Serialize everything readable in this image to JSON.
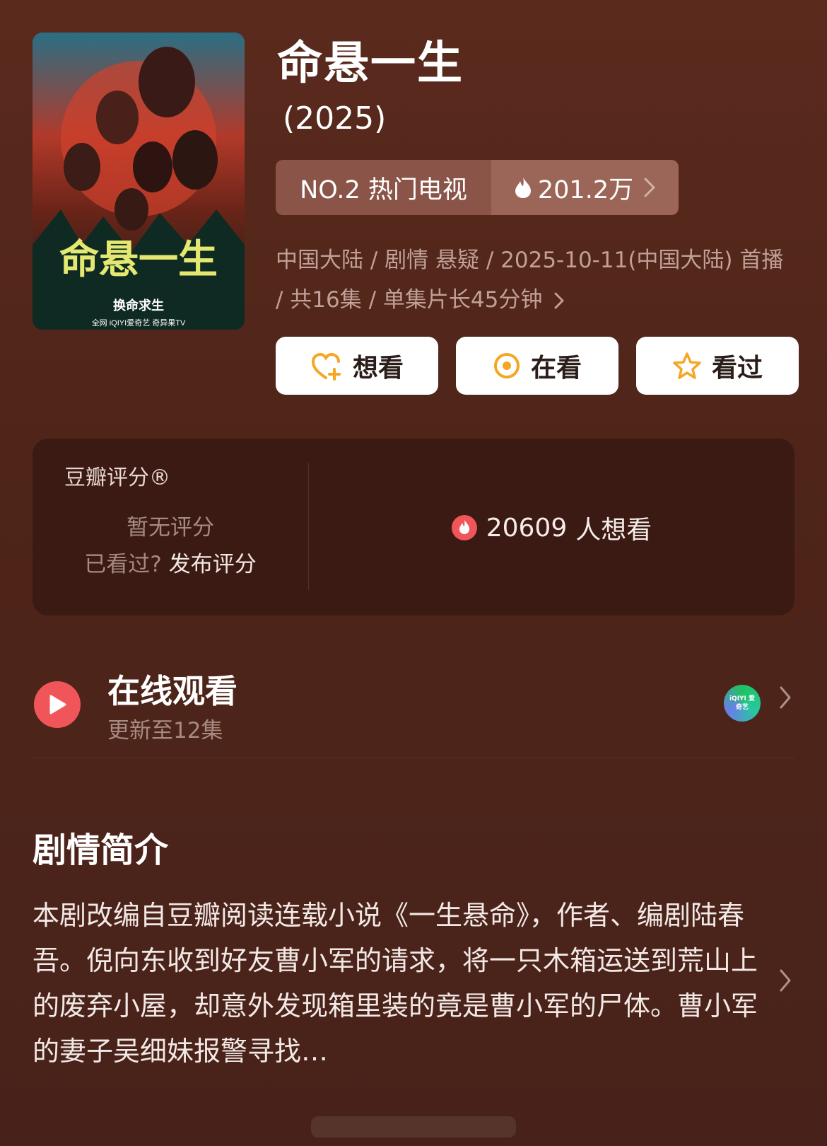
{
  "show": {
    "title": "命悬一生",
    "year": "(2025)",
    "poster": {
      "title_art": "命悬一生",
      "tagline": "换命求生",
      "footer": "全网 iQIYI爱奇艺 奇异果TV"
    }
  },
  "rank": {
    "label": "NO.2 热门电视",
    "heat": "201.2万",
    "heat_icon": "flame-icon"
  },
  "meta": {
    "text": "中国大陆 / 剧情 悬疑 / 2025-10-11(中国大陆) 首播 / 共16集 / 单集片长45分钟"
  },
  "actions": [
    {
      "label": "想看",
      "icon": "heart-plus-icon"
    },
    {
      "label": "在看",
      "icon": "target-icon"
    },
    {
      "label": "看过",
      "icon": "star-icon"
    }
  ],
  "rating": {
    "title": "豆瓣评分®",
    "none": "暂无评分",
    "watched_question": "已看过?",
    "publish_link": "发布评分",
    "want_count": "20609",
    "want_suffix": "人想看"
  },
  "online": {
    "title": "在线观看",
    "update": "更新至12集",
    "provider_logo": "iQIYI 爱奇艺"
  },
  "synopsis": {
    "title": "剧情简介",
    "text": "本剧改编自豆瓣阅读连载小说《一生悬命》，作者、编剧陆春吾。倪向东收到好友曹小军的请求，将一只木箱运送到荒山上的废弃小屋，却意外发现箱里装的竟是曹小军的尸体。曹小军的妻子吴细妹报警寻找…"
  },
  "colors": {
    "background": "#4f2519",
    "accent_red": "#f05659",
    "icon_orange": "#f5a623"
  }
}
